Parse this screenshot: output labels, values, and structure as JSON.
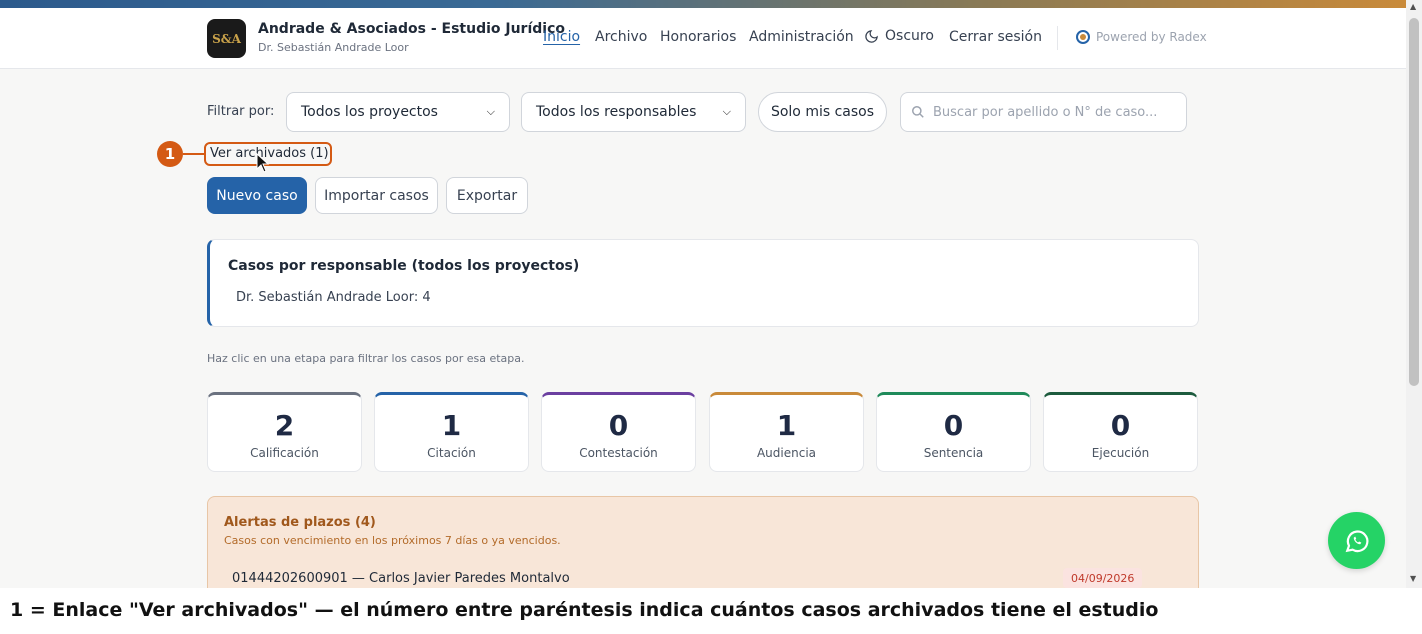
{
  "header": {
    "logo_text": "S&A",
    "firm_name": "Andrade & Asociados - Estudio Jurídico",
    "firm_sub": "Dr. Sebastián Andrade Loor",
    "nav": [
      "Inicio",
      "Archivo",
      "Honorarios",
      "Administración"
    ],
    "dark_mode": "Oscuro",
    "logout": "Cerrar sesión",
    "powered": "Powered by Radex",
    "icons": {
      "theme": "moon-icon",
      "powered": "radex-logo-icon"
    }
  },
  "filters": {
    "label": "Filtrar por:",
    "project_select": "Todos los proyectos",
    "responsible_select": "Todos los responsables",
    "mine_button": "Solo mis casos",
    "search_placeholder": "Buscar por apellido o N° de caso..."
  },
  "archived_link": "Ver archivados (1)",
  "actions": {
    "new_case": "Nuevo caso",
    "import": "Importar casos",
    "export": "Exportar"
  },
  "responsible_card": {
    "title": "Casos por responsable (todos los proyectos)",
    "items": [
      "Dr. Sebastián Andrade Loor: 4"
    ]
  },
  "stage_hint": "Haz clic en una etapa para filtrar los casos por esa etapa.",
  "stages": [
    {
      "count": "2",
      "label": "Calificación",
      "color": "#6b7280"
    },
    {
      "count": "1",
      "label": "Citación",
      "color": "#2563a8"
    },
    {
      "count": "0",
      "label": "Contestación",
      "color": "#6b3fa0"
    },
    {
      "count": "1",
      "label": "Audiencia",
      "color": "#c98a3a"
    },
    {
      "count": "0",
      "label": "Sentencia",
      "color": "#1f8a5a"
    },
    {
      "count": "0",
      "label": "Ejecución",
      "color": "#1d5b3e"
    }
  ],
  "alerts": {
    "title": "Alertas de plazos (4)",
    "subtitle": "Casos con vencimiento en los próximos 7 días o ya vencidos.",
    "rows": [
      {
        "text": "01444202600901 — Carlos Javier Paredes Montalvo",
        "date": "04/09/2026"
      }
    ]
  },
  "annotation": {
    "badge": "1",
    "caption": "1 = Enlace \"Ver archivados\" — el número entre paréntesis indica cuántos casos archivados tiene el estudio"
  },
  "colors": {
    "accent": "#2563a8",
    "annotation": "#d45a14",
    "whatsapp": "#25d366"
  }
}
